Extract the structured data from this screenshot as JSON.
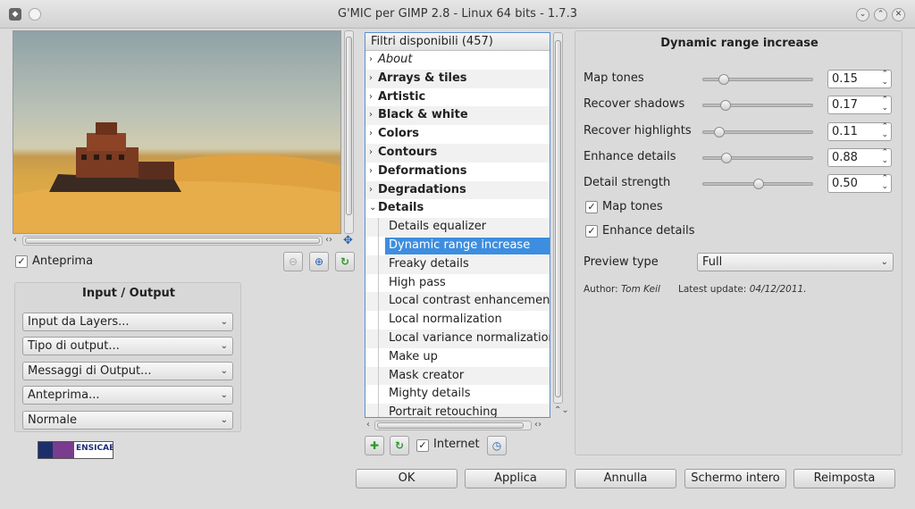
{
  "window": {
    "title": "G'MIC per GIMP 2.8 - Linux 64 bits - 1.7.3"
  },
  "preview": {
    "checkbox_label": "Anteprima",
    "checked": true
  },
  "io_panel": {
    "title": "Input / Output",
    "combos": [
      {
        "value": "Input da Layers..."
      },
      {
        "value": "Tipo di output..."
      },
      {
        "value": "Messaggi di Output..."
      },
      {
        "value": "Anteprima..."
      },
      {
        "value": "Normale"
      }
    ]
  },
  "logo": {
    "text": "ENSICAEN"
  },
  "filters": {
    "header": "Filtri disponibili (457)",
    "items": [
      {
        "label": "About",
        "style": "italic",
        "expander": "›"
      },
      {
        "label": "Arrays & tiles",
        "style": "bold",
        "expander": "›"
      },
      {
        "label": "Artistic",
        "style": "bold",
        "expander": "›"
      },
      {
        "label": "Black & white",
        "style": "bold",
        "expander": "›"
      },
      {
        "label": "Colors",
        "style": "bold",
        "expander": "›"
      },
      {
        "label": "Contours",
        "style": "bold",
        "expander": "›"
      },
      {
        "label": "Deformations",
        "style": "bold",
        "expander": "›"
      },
      {
        "label": "Degradations",
        "style": "bold",
        "expander": "›"
      },
      {
        "label": "Details",
        "style": "bold",
        "expander": "⌄"
      },
      {
        "label": "Details equalizer",
        "style": "child"
      },
      {
        "label": "Dynamic range increase",
        "style": "child",
        "selected": true
      },
      {
        "label": "Freaky details",
        "style": "child"
      },
      {
        "label": "High pass",
        "style": "child"
      },
      {
        "label": "Local contrast enhancement",
        "style": "child"
      },
      {
        "label": "Local normalization",
        "style": "child"
      },
      {
        "label": "Local variance normalization",
        "style": "child"
      },
      {
        "label": "Make up",
        "style": "child"
      },
      {
        "label": "Mask creator",
        "style": "child"
      },
      {
        "label": "Mighty details",
        "style": "child"
      },
      {
        "label": "Portrait retouching",
        "style": "child"
      }
    ],
    "internet_label": "Internet",
    "internet_checked": true
  },
  "filter_panel": {
    "title": "Dynamic range increase",
    "params": [
      {
        "label": "Map tones",
        "value": "0.15",
        "fraction": 0.15
      },
      {
        "label": "Recover shadows",
        "value": "0.17",
        "fraction": 0.17
      },
      {
        "label": "Recover highlights",
        "value": "0.11",
        "fraction": 0.11
      },
      {
        "label": "Enhance details",
        "value": "0.88",
        "fraction": 0.18
      },
      {
        "label": "Detail strength",
        "value": "0.50",
        "fraction": 0.5
      }
    ],
    "checks": [
      {
        "label": "Map tones",
        "checked": true
      },
      {
        "label": "Enhance details",
        "checked": true
      }
    ],
    "preview_type_label": "Preview type",
    "preview_type_value": "Full",
    "author_label": "Author:",
    "author_name": "Tom Keil",
    "update_label": "Latest update:",
    "update_value": "04/12/2011."
  },
  "buttons": {
    "ok": "OK",
    "apply": "Applica",
    "cancel": "Annulla",
    "fullscreen": "Schermo intero",
    "reset": "Reimposta"
  }
}
